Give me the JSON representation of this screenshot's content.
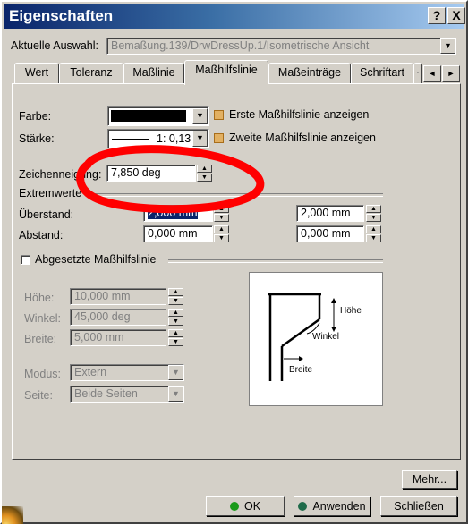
{
  "window": {
    "title": "Eigenschaften",
    "help": "?",
    "close": "X"
  },
  "selection": {
    "label": "Aktuelle Auswahl:",
    "value": "Bemaßung.139/DrwDressUp.1/Isometrische Ansicht"
  },
  "tabs": [
    "Wert",
    "Toleranz",
    "Maßlinie",
    "Maßhilfslinie",
    "Maßeinträge",
    "Schriftart"
  ],
  "tab_scroll": {
    "partial": "·",
    "left": "◄",
    "right": "►"
  },
  "form": {
    "farbe_label": "Farbe:",
    "staerke_label": "Stärke:",
    "staerke_value": "1: 0,13",
    "erste_label": "Erste Maßhilfslinie anzeigen",
    "zweite_label": "Zweite Maßhilfslinie anzeigen",
    "zeichen_label": "Zeichenneigung:",
    "zeichen_value": "7,850 deg",
    "extremwerte_label": "Extremwerte",
    "ueberstand_label": "Überstand:",
    "ueberstand_1": "2,000 mm",
    "ueberstand_2": "2,000 mm",
    "abstand_label": "Abstand:",
    "abstand_1": "0,000 mm",
    "abstand_2": "0,000 mm",
    "abgesetzte_label": "Abgesetzte Maßhilfslinie",
    "hoehe_label": "Höhe:",
    "hoehe_value": "10,000 mm",
    "winkel_label": "Winkel:",
    "winkel_value": "45,000 deg",
    "breite_label": "Breite:",
    "breite_value": "5,000 mm",
    "modus_label": "Modus:",
    "modus_value": "Extern",
    "seite_label": "Seite:",
    "seite_value": "Beide Seiten"
  },
  "diagram": {
    "hoehe": "Höhe",
    "winkel": "Winkel",
    "breite": "Breite"
  },
  "buttons": {
    "mehr": "Mehr...",
    "ok": "OK",
    "anwenden": "Anwenden",
    "schliessen": "Schließen"
  },
  "colors": {
    "titlebar": "#0a246a",
    "face": "#d4d0c8",
    "annotation": "#ff0000",
    "checkbox_checked": "#e2b062",
    "ok_dot": "#1a9a1a",
    "apply_dot": "#1f6b4a"
  }
}
